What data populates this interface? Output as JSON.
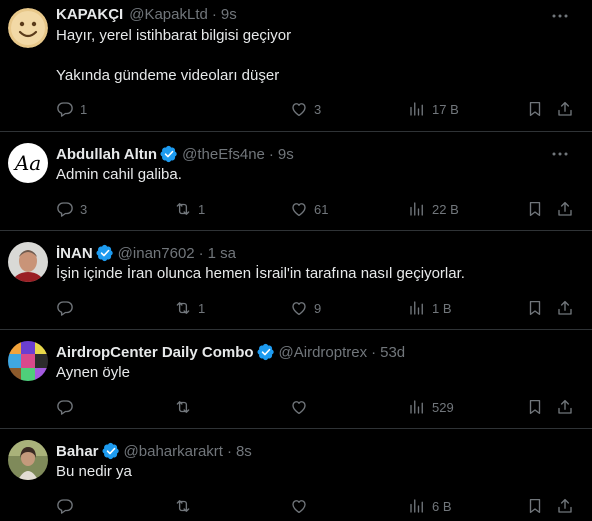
{
  "tweets": [
    {
      "name": "KAPAKÇI",
      "handle": "@KapakLtd",
      "time": "9s",
      "lines": [
        "Hayır, yerel istihbarat bilgisi geçiyor",
        "Yakında gündeme videoları düşer"
      ],
      "replies": "1",
      "retweets": "",
      "likes": "3",
      "views": "17 B",
      "verified": false,
      "avatar": "smiley-face-avatar"
    },
    {
      "name": "Abdullah Altın",
      "handle": "@theEfs4ne",
      "time": "9s",
      "lines": [
        "Admin cahil galiba."
      ],
      "replies": "3",
      "retweets": "1",
      "likes": "61",
      "views": "22 B",
      "verified": true,
      "avatar_text": "Aa"
    },
    {
      "name": "İNAN",
      "handle": "@inan7602",
      "time": "1 sa",
      "lines": [
        "İşin içinde İran olunca hemen İsrail'in tarafına nasıl geçiyorlar."
      ],
      "replies": "",
      "retweets": "1",
      "likes": "9",
      "views": "1 B",
      "verified": true,
      "avatar": "person-photo-avatar"
    },
    {
      "name": "AirdropCenter Daily Combo",
      "handle": "@Airdroptrex",
      "time": "53d",
      "lines": [
        "Aynen öyle"
      ],
      "replies": "",
      "retweets": "",
      "likes": "",
      "views": "529",
      "verified": true,
      "avatar": "crypto-collage-avatar"
    },
    {
      "name": "Bahar",
      "handle": "@baharkarakrt",
      "time": "8s",
      "lines": [
        "Bu nedir ya"
      ],
      "replies": "",
      "retweets": "",
      "likes": "",
      "views": "6 B",
      "verified": true,
      "avatar": "woman-photo-avatar"
    }
  ],
  "colors": {
    "background": "#000000",
    "text": "#e7e9ea",
    "muted": "#71767b",
    "verified": "#1d9bf0",
    "divider": "#2f3336"
  }
}
